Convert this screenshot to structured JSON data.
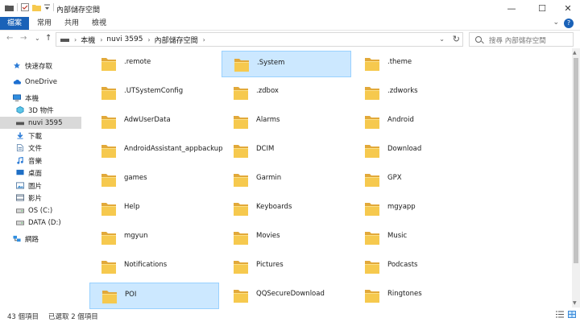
{
  "window": {
    "title": "內部儲存空間",
    "controls": {
      "minimize": "—",
      "maximize": "☐",
      "close": "✕"
    }
  },
  "ribbon": {
    "tabs": [
      "檔案",
      "常用",
      "共用",
      "檢視"
    ],
    "help": "?",
    "expand": "⌄"
  },
  "navigation": {
    "back": "←",
    "forward": "→",
    "recent": "⌄",
    "up": "↑",
    "breadcrumb": [
      "本機",
      "nuvi 3595",
      "內部儲存空間"
    ],
    "search_placeholder": "搜尋 內部儲存空間"
  },
  "sidebar": {
    "items": [
      {
        "label": "快速存取",
        "icon": "star-icon",
        "indent": 0,
        "selected": false
      },
      {
        "label": "OneDrive",
        "icon": "cloud-icon",
        "indent": 0,
        "selected": false
      },
      {
        "label": "本機",
        "icon": "computer-icon",
        "indent": 0,
        "selected": false
      },
      {
        "label": "3D 物件",
        "icon": "cube-icon",
        "indent": 1,
        "selected": false
      },
      {
        "label": "nuvi 3595",
        "icon": "device-icon",
        "indent": 1,
        "selected": true
      },
      {
        "label": "下載",
        "icon": "download-icon",
        "indent": 1,
        "selected": false
      },
      {
        "label": "文件",
        "icon": "document-icon",
        "indent": 1,
        "selected": false
      },
      {
        "label": "音樂",
        "icon": "music-icon",
        "indent": 1,
        "selected": false
      },
      {
        "label": "桌面",
        "icon": "desktop-icon",
        "indent": 1,
        "selected": false
      },
      {
        "label": "圖片",
        "icon": "pictures-icon",
        "indent": 1,
        "selected": false
      },
      {
        "label": "影片",
        "icon": "video-icon",
        "indent": 1,
        "selected": false
      },
      {
        "label": "OS (C:)",
        "icon": "drive-icon",
        "indent": 1,
        "selected": false
      },
      {
        "label": "DATA (D:)",
        "icon": "drive-icon",
        "indent": 1,
        "selected": false
      },
      {
        "label": "網路",
        "icon": "network-icon",
        "indent": 0,
        "selected": false
      }
    ]
  },
  "folders": [
    {
      "name": ".remote",
      "selected": false
    },
    {
      "name": ".System",
      "selected": true
    },
    {
      "name": ".theme",
      "selected": false
    },
    {
      "name": ".UTSystemConfig",
      "selected": false
    },
    {
      "name": ".zdbox",
      "selected": false
    },
    {
      "name": ".zdworks",
      "selected": false
    },
    {
      "name": "AdwUserData",
      "selected": false
    },
    {
      "name": "Alarms",
      "selected": false
    },
    {
      "name": "Android",
      "selected": false
    },
    {
      "name": "AndroidAssistant_appbackup",
      "selected": false
    },
    {
      "name": "DCIM",
      "selected": false
    },
    {
      "name": "Download",
      "selected": false
    },
    {
      "name": "games",
      "selected": false
    },
    {
      "name": "Garmin",
      "selected": false
    },
    {
      "name": "GPX",
      "selected": false
    },
    {
      "name": "Help",
      "selected": false
    },
    {
      "name": "Keyboards",
      "selected": false
    },
    {
      "name": "mgyapp",
      "selected": false
    },
    {
      "name": "mgyun",
      "selected": false
    },
    {
      "name": "Movies",
      "selected": false
    },
    {
      "name": "Music",
      "selected": false
    },
    {
      "name": "Notifications",
      "selected": false
    },
    {
      "name": "Pictures",
      "selected": false
    },
    {
      "name": "Podcasts",
      "selected": false
    },
    {
      "name": "POI",
      "selected": true
    },
    {
      "name": "QQSecureDownload",
      "selected": false
    },
    {
      "name": "Ringtones",
      "selected": false
    }
  ],
  "status": {
    "item_count": "43 個項目",
    "selected_count": "已選取 2 個項目"
  },
  "colors": {
    "accent": "#1a62b8",
    "selection_fill": "#cce8ff",
    "selection_border": "#99d1ff",
    "folder": "#f6c94e"
  }
}
